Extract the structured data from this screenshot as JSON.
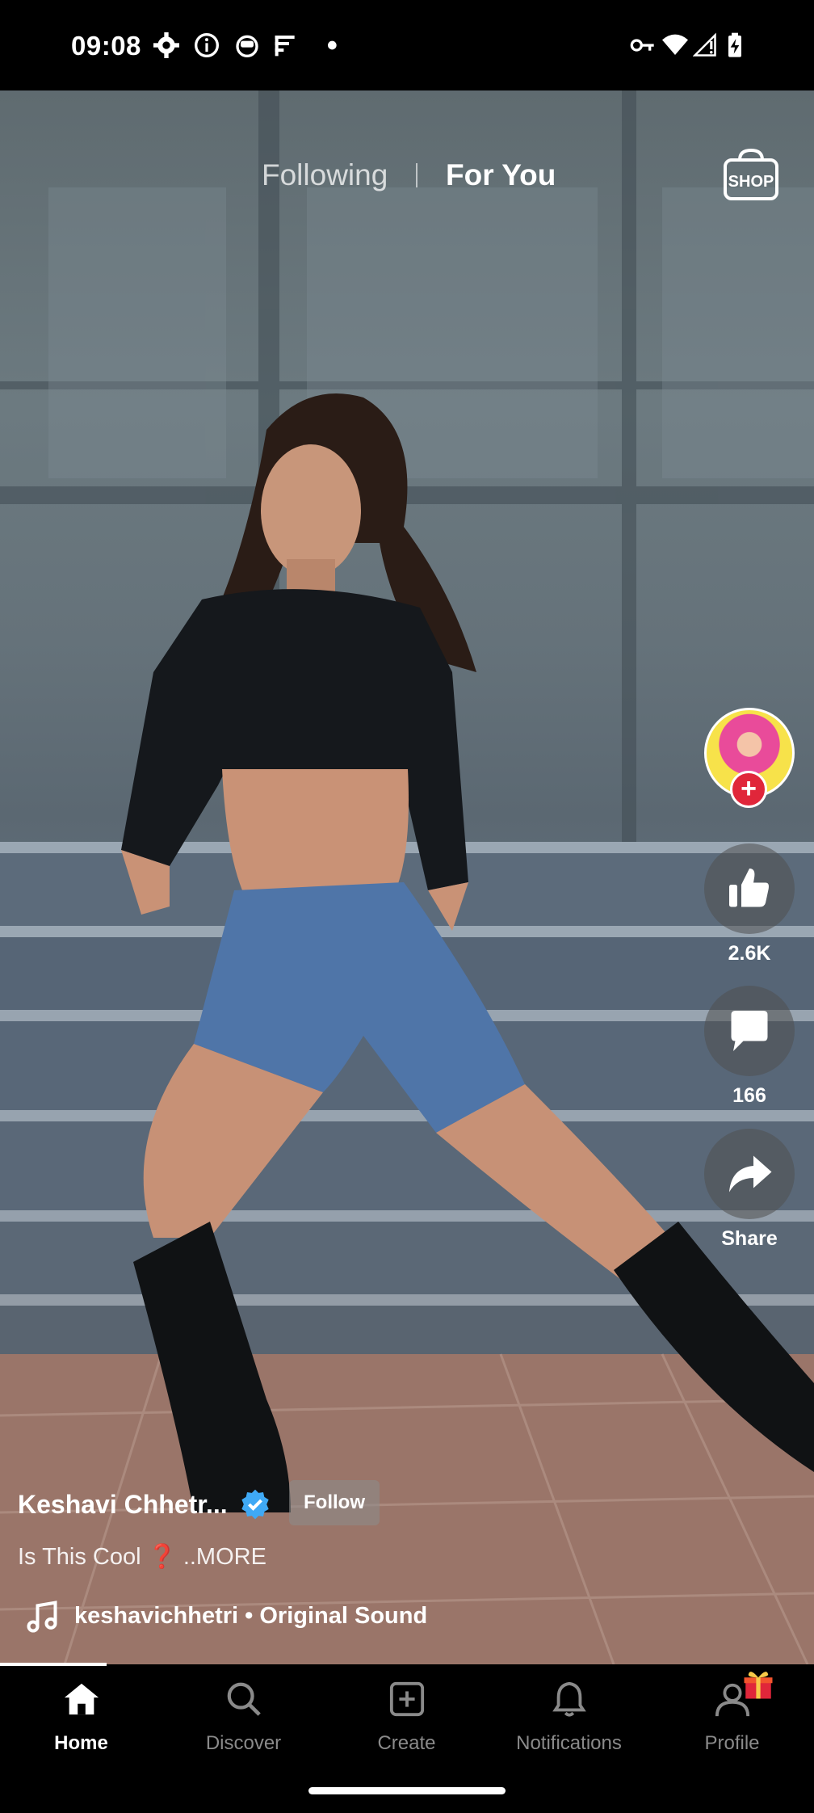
{
  "status_bar": {
    "time": "09:08",
    "left_icons": [
      "settings-icon",
      "info-icon",
      "notification-app-icon",
      "signal-app-icon",
      "dot-icon"
    ],
    "right_icons": [
      "vpn-key-icon",
      "wifi-icon",
      "cellular-signal-icon",
      "battery-charging-icon"
    ]
  },
  "top_tabs": {
    "following": "Following",
    "for_you": "For You",
    "active": "For You",
    "shop_label": "SHOP"
  },
  "actions": {
    "likes": "2.6K",
    "comments": "166",
    "share": "Share"
  },
  "post": {
    "username": "Keshavi Chhetr...",
    "verified": true,
    "follow_label": "Follow",
    "caption_text": "Is This Cool",
    "caption_emoji": "❓",
    "caption_more": "..MORE",
    "sound": "keshavichhetri • Original Sound"
  },
  "bottom_nav": {
    "items": [
      {
        "label": "Home",
        "icon": "home-icon",
        "active": true
      },
      {
        "label": "Discover",
        "icon": "search-icon",
        "active": false
      },
      {
        "label": "Create",
        "icon": "create-icon",
        "active": false
      },
      {
        "label": "Notifications",
        "icon": "bell-icon",
        "active": false
      },
      {
        "label": "Profile",
        "icon": "profile-icon",
        "active": false
      }
    ]
  },
  "colors": {
    "accent_red": "#e0263a",
    "verified_blue": "#3fa9f5",
    "inactive_nav": "#8a8a8a"
  }
}
